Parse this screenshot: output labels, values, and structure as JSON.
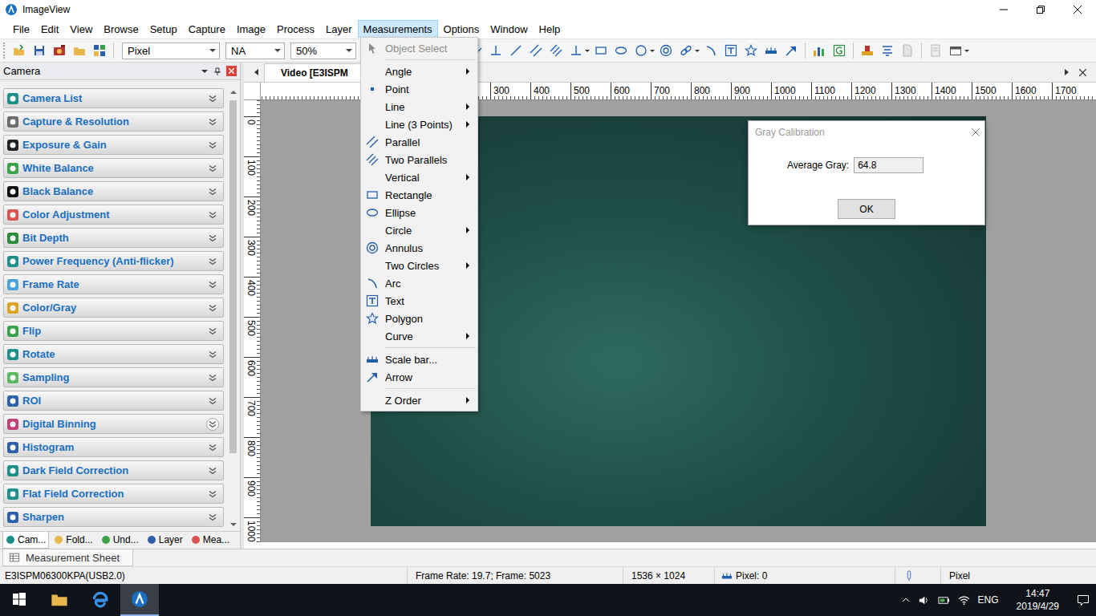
{
  "window": {
    "title": "ImageView"
  },
  "menubar": [
    {
      "label": "File",
      "selected": false
    },
    {
      "label": "Edit",
      "selected": false
    },
    {
      "label": "View",
      "selected": false
    },
    {
      "label": "Browse",
      "selected": false
    },
    {
      "label": "Setup",
      "selected": false
    },
    {
      "label": "Capture",
      "selected": false
    },
    {
      "label": "Image",
      "selected": false
    },
    {
      "label": "Process",
      "selected": false
    },
    {
      "label": "Layer",
      "selected": false
    },
    {
      "label": "Measurements",
      "selected": true
    },
    {
      "label": "Options",
      "selected": false
    },
    {
      "label": "Window",
      "selected": false
    },
    {
      "label": "Help",
      "selected": false
    }
  ],
  "toolbar": {
    "unit": "Pixel",
    "objective": "NA",
    "zoom": "50%"
  },
  "side_panel": {
    "title": "Camera",
    "items": [
      {
        "label": "Camera List",
        "highlighted": false
      },
      {
        "label": "Capture & Resolution",
        "highlighted": false
      },
      {
        "label": "Exposure & Gain",
        "highlighted": false
      },
      {
        "label": "White Balance",
        "highlighted": false
      },
      {
        "label": "Black Balance",
        "highlighted": false
      },
      {
        "label": "Color Adjustment",
        "highlighted": false
      },
      {
        "label": "Bit Depth",
        "highlighted": false
      },
      {
        "label": "Power Frequency (Anti-flicker)",
        "highlighted": false
      },
      {
        "label": "Frame Rate",
        "highlighted": false
      },
      {
        "label": "Color/Gray",
        "highlighted": false
      },
      {
        "label": "Flip",
        "highlighted": false
      },
      {
        "label": "Rotate",
        "highlighted": false
      },
      {
        "label": "Sampling",
        "highlighted": false
      },
      {
        "label": "ROI",
        "highlighted": false
      },
      {
        "label": "Digital Binning",
        "highlighted": true
      },
      {
        "label": "Histogram",
        "highlighted": false
      },
      {
        "label": "Dark Field Correction",
        "highlighted": false
      },
      {
        "label": "Flat Field Correction",
        "highlighted": false
      },
      {
        "label": "Sharpen",
        "highlighted": false
      }
    ],
    "tabs": [
      {
        "label": "Cam...",
        "selected": true
      },
      {
        "label": "Fold...",
        "selected": false
      },
      {
        "label": "Und...",
        "selected": false
      },
      {
        "label": "Layer",
        "selected": false
      },
      {
        "label": "Mea...",
        "selected": false
      }
    ]
  },
  "document": {
    "tabs": [
      {
        "label": "Video [E3ISPM",
        "selected": true
      }
    ],
    "ruler_x": [
      "300",
      "400",
      "500",
      "600",
      "700",
      "800",
      "900",
      "1000",
      "1100",
      "1200",
      "1300",
      "1400",
      "1500",
      "1600",
      "1700"
    ],
    "ruler_y": [
      "0",
      "100",
      "200",
      "300",
      "400",
      "500",
      "600",
      "700",
      "800",
      "900",
      "1000"
    ]
  },
  "measurements_menu": {
    "items": [
      {
        "kind": "item",
        "label": "Object Select",
        "disabled": true,
        "submenu": false
      },
      {
        "kind": "separator"
      },
      {
        "kind": "item",
        "label": "Angle",
        "disabled": false,
        "submenu": true
      },
      {
        "kind": "item",
        "label": "Point",
        "disabled": false,
        "submenu": false
      },
      {
        "kind": "item",
        "label": "Line",
        "disabled": false,
        "submenu": true
      },
      {
        "kind": "item",
        "label": "Line (3 Points)",
        "disabled": false,
        "submenu": true
      },
      {
        "kind": "item",
        "label": "Parallel",
        "disabled": false,
        "submenu": false
      },
      {
        "kind": "item",
        "label": "Two Parallels",
        "disabled": false,
        "submenu": false
      },
      {
        "kind": "item",
        "label": "Vertical",
        "disabled": false,
        "submenu": true
      },
      {
        "kind": "item",
        "label": "Rectangle",
        "disabled": false,
        "submenu": false
      },
      {
        "kind": "item",
        "label": "Ellipse",
        "disabled": false,
        "submenu": false
      },
      {
        "kind": "item",
        "label": "Circle",
        "disabled": false,
        "submenu": true
      },
      {
        "kind": "item",
        "label": "Annulus",
        "disabled": false,
        "submenu": false
      },
      {
        "kind": "item",
        "label": "Two Circles",
        "disabled": false,
        "submenu": true
      },
      {
        "kind": "item",
        "label": "Arc",
        "disabled": false,
        "submenu": false
      },
      {
        "kind": "item",
        "label": "Text",
        "disabled": false,
        "submenu": false
      },
      {
        "kind": "item",
        "label": "Polygon",
        "disabled": false,
        "submenu": false
      },
      {
        "kind": "item",
        "label": "Curve",
        "disabled": false,
        "submenu": true
      },
      {
        "kind": "separator"
      },
      {
        "kind": "item",
        "label": "Scale bar...",
        "disabled": false,
        "submenu": false
      },
      {
        "kind": "item",
        "label": "Arrow",
        "disabled": false,
        "submenu": false
      },
      {
        "kind": "separator"
      },
      {
        "kind": "item",
        "label": "Z Order",
        "disabled": false,
        "submenu": true
      }
    ]
  },
  "dialog": {
    "title": "Gray Calibration",
    "active": false,
    "field_label": "Average Gray:",
    "value": "64.8",
    "buttons": [
      "OK"
    ]
  },
  "bottom_tabs": [
    {
      "label": "Measurement Sheet",
      "selected": true
    }
  ],
  "status_bar": {
    "device": "E3ISPM06300KPA(USB2.0)",
    "frame": "Frame Rate: 19.7; Frame: 5023",
    "size": "1536 × 1024",
    "pixel": "Pixel: 0",
    "unit": "Pixel"
  },
  "taskbar": {
    "language": "ENG",
    "time": "14:47",
    "date": "2019/4/29"
  }
}
